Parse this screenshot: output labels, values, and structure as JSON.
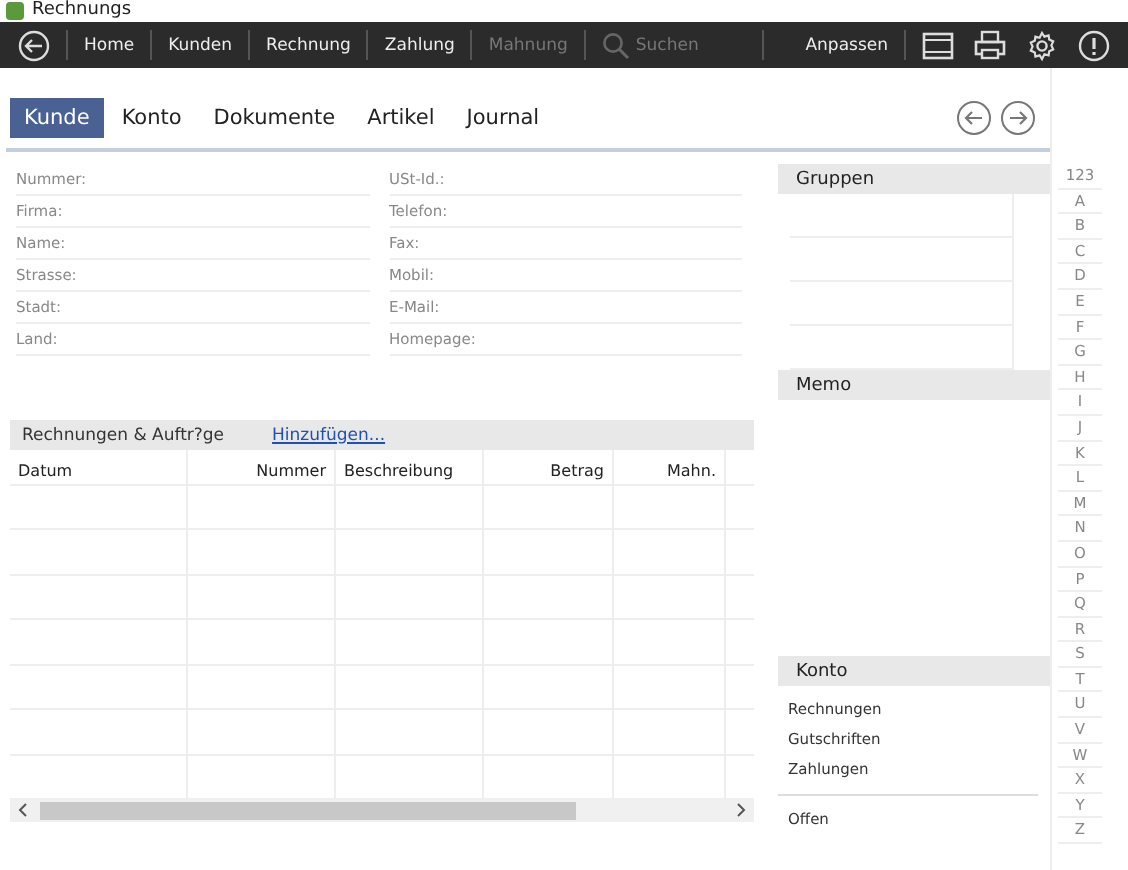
{
  "window": {
    "title": "Rechnungs"
  },
  "toolbar": {
    "items": [
      {
        "label": "Home",
        "disabled": false
      },
      {
        "label": "Kunden",
        "disabled": false
      },
      {
        "label": "Rechnung",
        "disabled": false
      },
      {
        "label": "Zahlung",
        "disabled": false
      },
      {
        "label": "Mahnung",
        "disabled": true
      }
    ],
    "search": {
      "placeholder": "Suchen"
    },
    "customize": "Anpassen"
  },
  "tabs": [
    {
      "label": "Kunde",
      "selected": true
    },
    {
      "label": "Konto",
      "selected": false
    },
    {
      "label": "Dokumente",
      "selected": false
    },
    {
      "label": "Artikel",
      "selected": false
    },
    {
      "label": "Journal",
      "selected": false
    }
  ],
  "form": {
    "left": [
      "Nummer:",
      "Firma:",
      "Name:",
      "Strasse:",
      "Stadt:",
      "Land:"
    ],
    "right": [
      "USt-Id.:",
      "Telefon:",
      "Fax:",
      "Mobil:",
      "E-Mail:",
      "Homepage:"
    ]
  },
  "documents": {
    "title": "Rechnungen & Auftr?ge",
    "add_link": "Hinzufügen...",
    "columns": [
      "Datum",
      "Nummer",
      "Beschreibung",
      "Betrag",
      "Mahn."
    ]
  },
  "groups": {
    "title": "Gruppen"
  },
  "memo": {
    "title": "Memo"
  },
  "account": {
    "title": "Konto",
    "items": [
      "Rechnungen",
      "Gutschriften",
      "Zahlungen"
    ],
    "balance_label": "Offen"
  },
  "index": [
    "123",
    "A",
    "B",
    "C",
    "D",
    "E",
    "F",
    "G",
    "H",
    "I",
    "J",
    "K",
    "L",
    "M",
    "N",
    "O",
    "P",
    "Q",
    "R",
    "S",
    "T",
    "U",
    "V",
    "W",
    "X",
    "Y",
    "Z"
  ]
}
